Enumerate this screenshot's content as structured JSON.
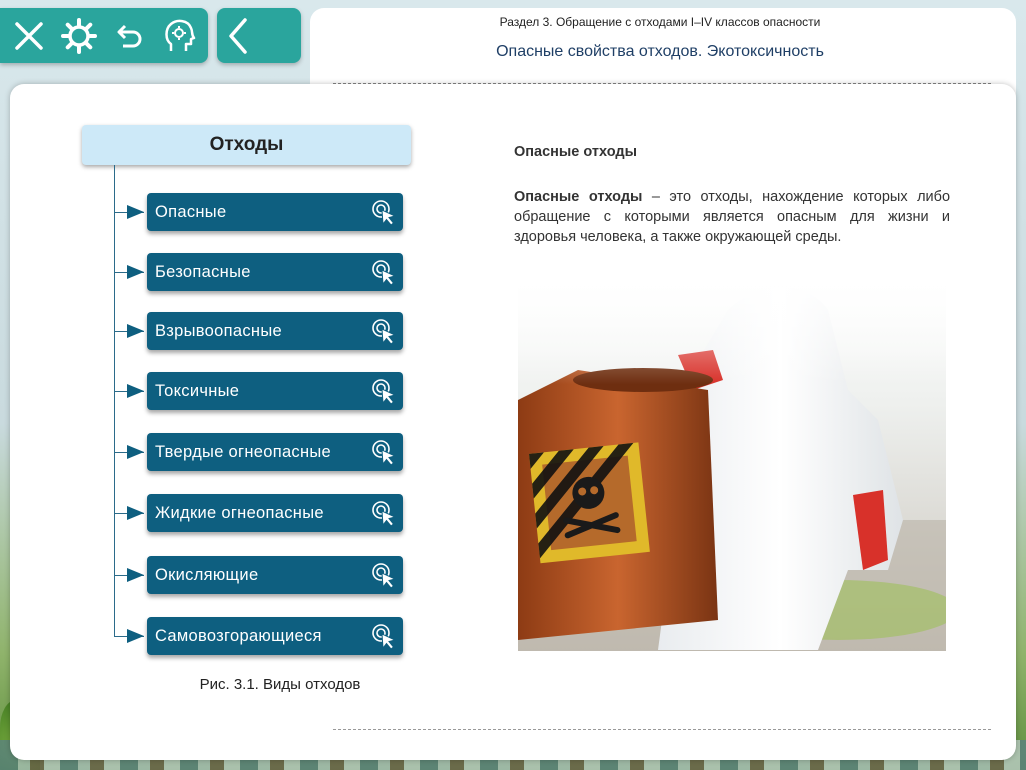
{
  "toolbar": {
    "icons": [
      "close-icon",
      "gear-icon",
      "undo-icon",
      "head-gear-icon"
    ],
    "back_icon": "chevron-left-icon",
    "accent": "#2aa59d"
  },
  "header": {
    "section": "Раздел 3. Обращение с отходами I–IV классов опасности",
    "title": "Опасные свойства отходов. Экотоксичность"
  },
  "diagram": {
    "root_label": "Отходы",
    "items": [
      {
        "label": "Опасные"
      },
      {
        "label": "Безопасные"
      },
      {
        "label": "Взрывоопасные"
      },
      {
        "label": "Токсичные"
      },
      {
        "label": "Твердые огнеопасные"
      },
      {
        "label": "Жидкие огнеопасные"
      },
      {
        "label": "Окисляющие"
      },
      {
        "label": "Самовозгорающиеся"
      }
    ],
    "item_icon": "click-pointer-icon",
    "item_color": "#0e5f80",
    "root_color": "#cde9f8",
    "caption": "Рис. 3.1. Виды отходов"
  },
  "content": {
    "subtitle": "Опасные отходы",
    "term": "Опасные отходы",
    "definition": " – это отходы, нахождение которых либо обращение с которыми является опасным для жизни и здоровья человека, а также окружающей среды."
  }
}
